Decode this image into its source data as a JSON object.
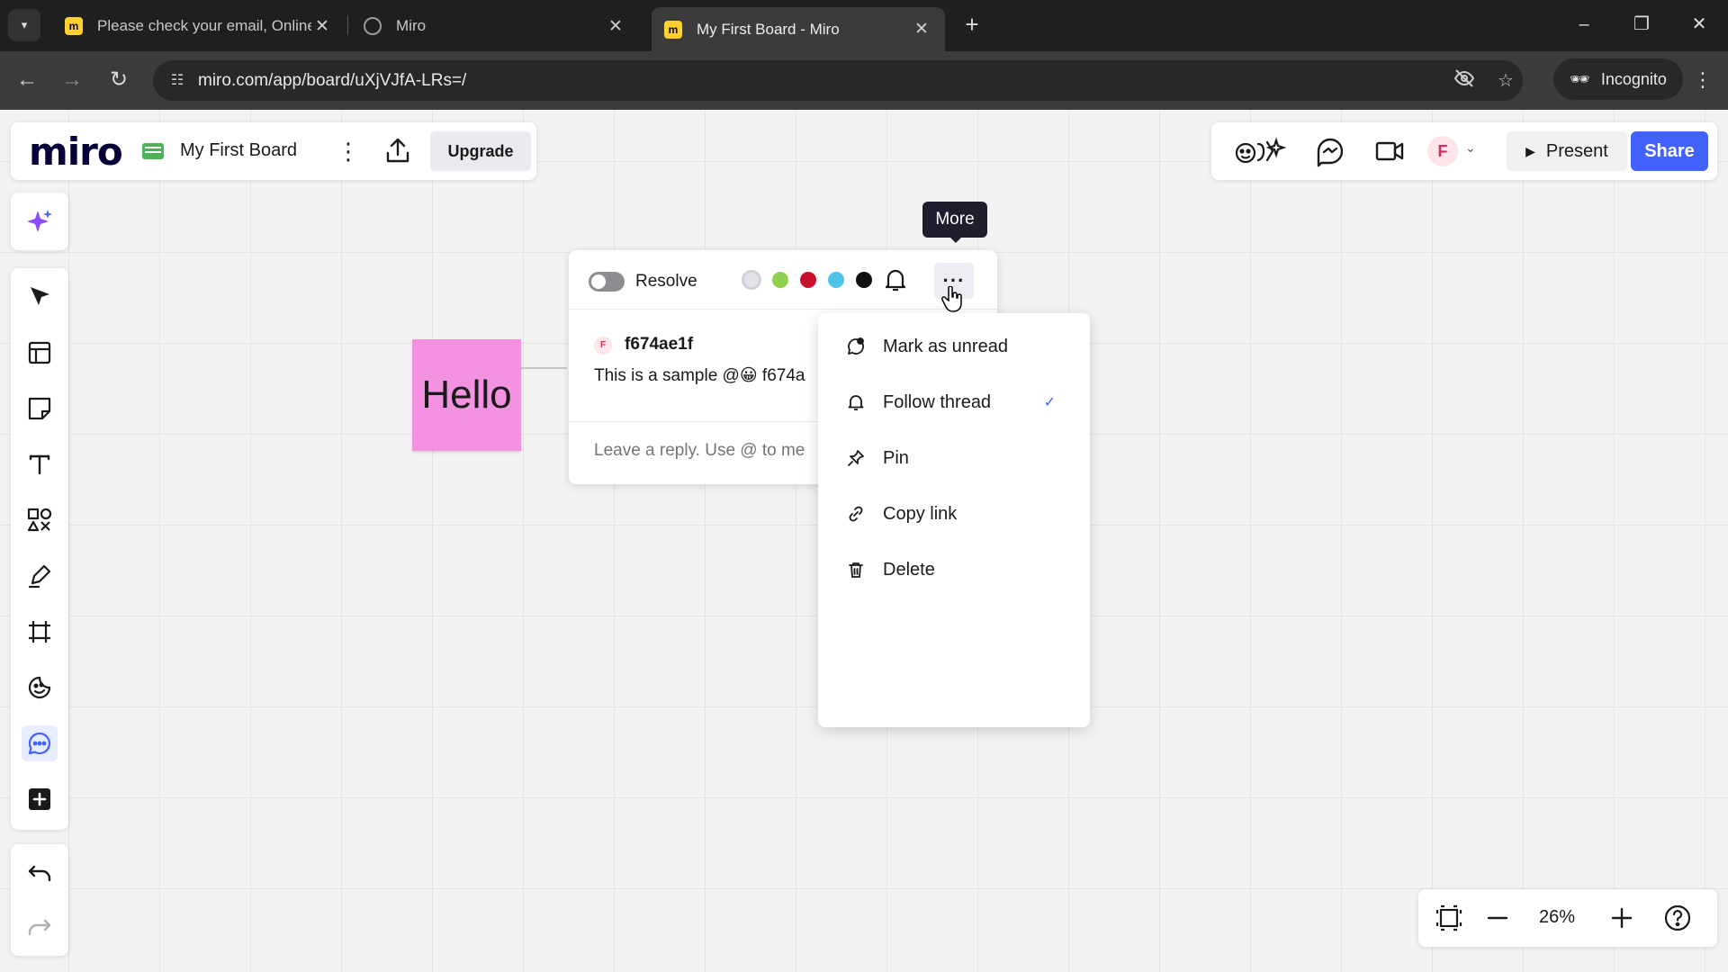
{
  "browser": {
    "tabs": [
      {
        "title": "Please check your email, Online",
        "active": false
      },
      {
        "title": "Miro",
        "active": false
      },
      {
        "title": "My First Board - Miro",
        "active": true
      }
    ],
    "url": "miro.com/app/board/uXjVJfA-LRs=/",
    "incognito_label": "Incognito"
  },
  "app": {
    "logo": "miro",
    "board_name": "My First Board",
    "upgrade_label": "Upgrade",
    "avatar_initial": "F",
    "present_label": "Present",
    "share_label": "Share",
    "zoom_level": "26%"
  },
  "canvas": {
    "sticky_text": "Hello",
    "sticky_color": "#f292e0"
  },
  "thread": {
    "resolve_label": "Resolve",
    "colors": [
      "#e2e3ea",
      "#8fd14f",
      "#c8102e",
      "#4dc3e8",
      "#111111"
    ],
    "author_initial": "F",
    "author": "f674ae1f",
    "message": "This is a sample @😀 f674a",
    "reply_placeholder": "Leave a reply. Use @ to me"
  },
  "tooltip": {
    "text": "More"
  },
  "menu": {
    "items": [
      {
        "label": "Mark as unread",
        "icon": "mark-unread-icon",
        "checked": false
      },
      {
        "label": "Follow thread",
        "icon": "bell-icon",
        "checked": true
      },
      {
        "label": "Pin",
        "icon": "pin-icon",
        "checked": false
      },
      {
        "label": "Copy link",
        "icon": "link-icon",
        "checked": false
      },
      {
        "label": "Delete",
        "icon": "trash-icon",
        "checked": false
      }
    ],
    "check_glyph": "✓"
  },
  "theme": {
    "accent": "#4262ff",
    "brand_dark": "#050038"
  }
}
